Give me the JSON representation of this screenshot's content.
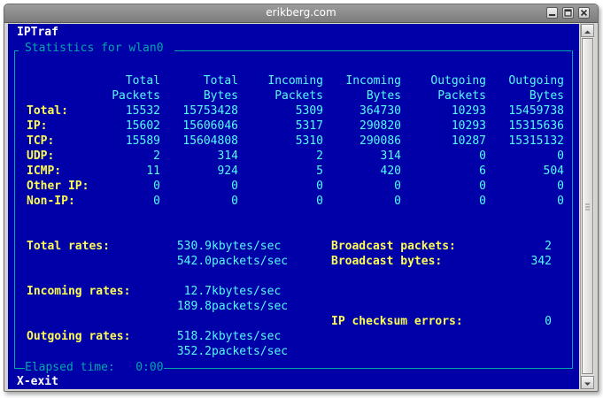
{
  "window": {
    "title": "erikberg.com"
  },
  "app": {
    "name": "IPTraf",
    "section": "Statistics for wlan0"
  },
  "table": {
    "headers": [
      [
        "Total",
        "Packets"
      ],
      [
        "Total",
        "Bytes"
      ],
      [
        "Incoming",
        "Packets"
      ],
      [
        "Incoming",
        "Bytes"
      ],
      [
        "Outgoing",
        "Packets"
      ],
      [
        "Outgoing",
        "Bytes"
      ]
    ],
    "rows": [
      {
        "label": "Total:",
        "values": [
          "15532",
          "15753428",
          "5309",
          "364730",
          "10293",
          "15459738"
        ]
      },
      {
        "label": "IP:",
        "values": [
          "15602",
          "15606046",
          "5317",
          "290820",
          "10293",
          "15315636"
        ]
      },
      {
        "label": "TCP:",
        "values": [
          "15589",
          "15604808",
          "5310",
          "290086",
          "10287",
          "15315132"
        ]
      },
      {
        "label": "UDP:",
        "values": [
          "2",
          "314",
          "2",
          "314",
          "0",
          "0"
        ]
      },
      {
        "label": "ICMP:",
        "values": [
          "11",
          "924",
          "5",
          "420",
          "6",
          "504"
        ]
      },
      {
        "label": "Other IP:",
        "values": [
          "0",
          "0",
          "0",
          "0",
          "0",
          "0"
        ]
      },
      {
        "label": "Non-IP:",
        "values": [
          "0",
          "0",
          "0",
          "0",
          "0",
          "0"
        ]
      }
    ]
  },
  "rates": {
    "total_label": "Total rates:",
    "total_kbytes": "530.9",
    "total_packets": "542.0",
    "incoming_label": "Incoming rates:",
    "incoming_kbytes": "12.7",
    "incoming_packets": "189.8",
    "outgoing_label": "Outgoing rates:",
    "outgoing_kbytes": "518.2",
    "outgoing_packets": "352.2",
    "kbytes_unit": "kbytes/sec",
    "packets_unit": "packets/sec"
  },
  "broadcast": {
    "packets_label": "Broadcast packets:",
    "packets_value": "2",
    "bytes_label": "Broadcast bytes:",
    "bytes_value": "342"
  },
  "checksum": {
    "label": "IP checksum errors:",
    "value": "0"
  },
  "elapsed": {
    "label": "Elapsed time:",
    "value": "0:00"
  },
  "footer": {
    "exit_key": "X",
    "exit_label": "-exit"
  },
  "colors": {
    "terminal_bg": "#0000a8",
    "label_yellow": "#fcfc54",
    "value_cyan": "#54fcfc",
    "border_cyan": "#00a8a8"
  }
}
